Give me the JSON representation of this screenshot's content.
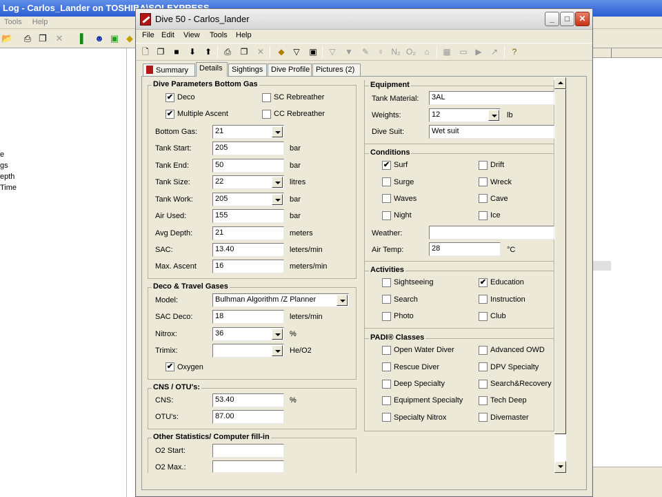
{
  "background": {
    "title": "Log - Carlos_Lander on TOSHIBA\\SQLEXPRESS",
    "menu": [
      "Tools",
      "Help"
    ],
    "left_items": [
      "e",
      "gs",
      "epth",
      " Time"
    ]
  },
  "dialog": {
    "title": "Dive 50 - Carlos_lander",
    "menu": [
      "File",
      "Edit",
      "View",
      "Tools",
      "Help"
    ],
    "tabs": [
      "Summary",
      "Details",
      "Sightings",
      "Dive Profile",
      "Pictures (2)"
    ],
    "active_tab": "Details"
  },
  "dive_params": {
    "title": "Dive Parameters Bottom Gas",
    "deco": {
      "label": "Deco",
      "checked": true
    },
    "sc_rebreather": {
      "label": "SC Rebreather",
      "checked": false
    },
    "multiple_ascent": {
      "label": "Multiple Ascent",
      "checked": true
    },
    "cc_rebreather": {
      "label": "CC Rebreather",
      "checked": false
    },
    "bottom_gas": {
      "label": "Bottom Gas:",
      "value": "21"
    },
    "tank_start": {
      "label": "Tank Start:",
      "value": "205",
      "unit": "bar"
    },
    "tank_end": {
      "label": "Tank End:",
      "value": "50",
      "unit": "bar"
    },
    "tank_size": {
      "label": "Tank Size:",
      "value": "22",
      "unit": "litres"
    },
    "tank_work": {
      "label": "Tank Work:",
      "value": "205",
      "unit": "bar"
    },
    "air_used": {
      "label": "Air Used:",
      "value": "155",
      "unit": "bar"
    },
    "avg_depth": {
      "label": "Avg Depth:",
      "value": "21",
      "unit": "meters"
    },
    "sac": {
      "label": "SAC:",
      "value": "13.40",
      "unit": "leters/min"
    },
    "max_ascent": {
      "label": "Max. Ascent",
      "value": "16",
      "unit": "meters/min"
    }
  },
  "deco_gases": {
    "title": "Deco & Travel Gases",
    "model": {
      "label": "Model:",
      "value": "Bulhman Algorithm /Z Planner"
    },
    "sac_deco": {
      "label": "SAC Deco:",
      "value": "18",
      "unit": "leters/min"
    },
    "nitrox": {
      "label": "Nitrox:",
      "value": "36",
      "unit": "%"
    },
    "trimix": {
      "label": "Trimix:",
      "value": "",
      "unit": "He/O2"
    },
    "oxygen": {
      "label": "Oxygen",
      "checked": true
    }
  },
  "cns": {
    "title": "CNS / OTU's:",
    "cns": {
      "label": "CNS:",
      "value": "53.40",
      "unit": "%"
    },
    "otu": {
      "label": "OTU's:",
      "value": "87.00"
    }
  },
  "other_stats": {
    "title": "Other Statistics/ Computer fill-in",
    "o2_start": {
      "label": "O2 Start:",
      "value": ""
    },
    "o2_max": {
      "label": "O2 Max.:",
      "value": ""
    }
  },
  "equipment": {
    "title": "Equipment",
    "tank_material": {
      "label": "Tank Material:",
      "value": "3AL"
    },
    "weights": {
      "label": "Weights:",
      "value": "12",
      "unit": "lb"
    },
    "dive_suit": {
      "label": "Dive Suit:",
      "value": "Wet suit"
    }
  },
  "conditions": {
    "title": "Conditions",
    "items": [
      {
        "label": "Surf",
        "checked": true
      },
      {
        "label": "Drift",
        "checked": false
      },
      {
        "label": "Surge",
        "checked": false
      },
      {
        "label": "Wreck",
        "checked": false
      },
      {
        "label": "Waves",
        "checked": false
      },
      {
        "label": "Cave",
        "checked": false
      },
      {
        "label": "Night",
        "checked": false
      },
      {
        "label": "Ice",
        "checked": false
      }
    ],
    "weather": {
      "label": "Weather:",
      "value": ""
    },
    "air_temp": {
      "label": "Air Temp:",
      "value": "28",
      "unit": "°C"
    }
  },
  "activities": {
    "title": "Activities",
    "items": [
      {
        "label": "Sightseeing",
        "checked": false
      },
      {
        "label": "Education",
        "checked": true
      },
      {
        "label": "Search",
        "checked": false
      },
      {
        "label": "Instruction",
        "checked": false
      },
      {
        "label": "Photo",
        "checked": false
      },
      {
        "label": "Club",
        "checked": false
      }
    ]
  },
  "padi": {
    "title": "PADI® Classes",
    "items": [
      {
        "label": "Open Water Diver",
        "checked": false
      },
      {
        "label": "Advanced OWD",
        "checked": false
      },
      {
        "label": "Rescue Diver",
        "checked": false
      },
      {
        "label": "DPV Specialty",
        "checked": false
      },
      {
        "label": "Deep Specialty",
        "checked": false
      },
      {
        "label": "Search&Recovery",
        "checked": false
      },
      {
        "label": "Equipment Specialty",
        "checked": false
      },
      {
        "label": "Tech Deep",
        "checked": false
      },
      {
        "label": "Specialty Nitrox",
        "checked": false
      },
      {
        "label": "Divemaster",
        "checked": false
      }
    ]
  }
}
